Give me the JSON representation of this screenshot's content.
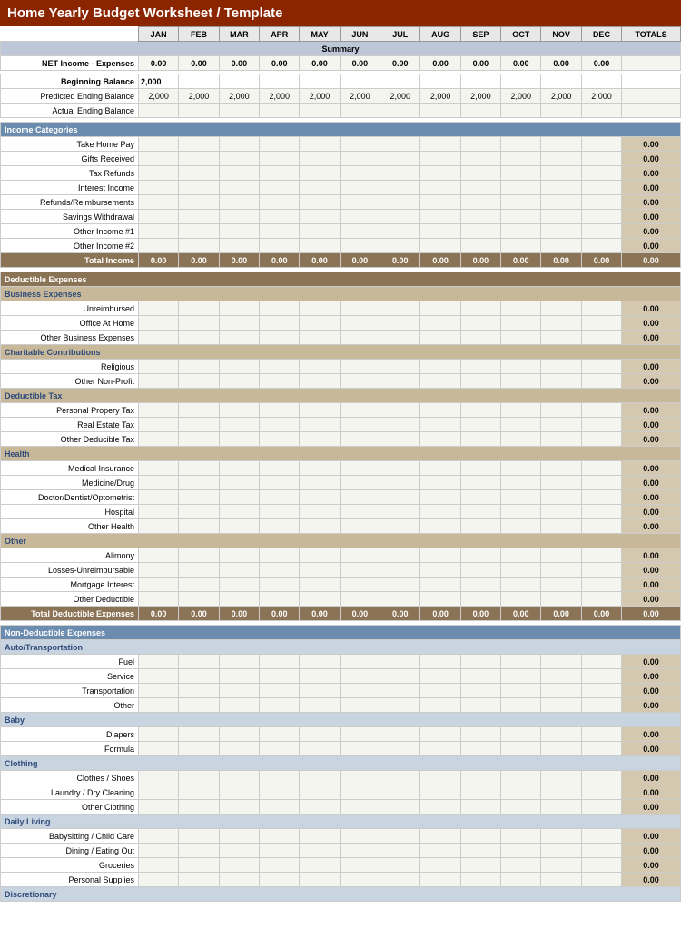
{
  "title": "Home Yearly Budget Worksheet / Template",
  "columns": [
    "",
    "JAN",
    "FEB",
    "MAR",
    "APR",
    "MAY",
    "JUN",
    "JUL",
    "AUG",
    "SEP",
    "OCT",
    "NOV",
    "DEC",
    "TOTALS"
  ],
  "summary": {
    "label": "Summary",
    "net_income_label": "NET Income - Expenses",
    "beginning_balance_label": "Beginning Balance",
    "beginning_balance_value": "2,000",
    "predicted_ending_label": "Predicted Ending Balance",
    "actual_ending_label": "Actual Ending Balance",
    "predicted_values": [
      "2,000",
      "2,000",
      "2,000",
      "2,000",
      "2,000",
      "2,000",
      "2,000",
      "2,000",
      "2,000",
      "2,000",
      "2,000",
      "2,000"
    ],
    "zero_row": [
      "0.00",
      "0.00",
      "0.00",
      "0.00",
      "0.00",
      "0.00",
      "0.00",
      "0.00",
      "0.00",
      "0.00",
      "0.00",
      "0.00",
      ""
    ]
  },
  "income": {
    "section_label": "Income Categories",
    "items": [
      "Take Home Pay",
      "Gifts Received",
      "Tax Refunds",
      "Interest Income",
      "Refunds/Reimbursements",
      "Savings Withdrawal",
      "Other Income #1",
      "Other Income #2"
    ],
    "total_label": "Total Income",
    "total_values": [
      "0.00",
      "0.00",
      "0.00",
      "0.00",
      "0.00",
      "0.00",
      "0.00",
      "0.00",
      "0.00",
      "0.00",
      "0.00",
      "0.00",
      "0.00"
    ]
  },
  "deductible": {
    "section_label": "Deductible Expenses",
    "subsections": [
      {
        "name": "Business Expenses",
        "items": [
          "Unreimbursed",
          "Office At Home",
          "Other Business Expenses"
        ]
      },
      {
        "name": "Charitable Contributions",
        "items": [
          "Religious",
          "Other Non-Profit"
        ]
      },
      {
        "name": "Deductible Tax",
        "items": [
          "Personal Propery Tax",
          "Real Estate Tax",
          "Other Deducible Tax"
        ]
      },
      {
        "name": "Health",
        "items": [
          "Medical Insurance",
          "Medicine/Drug",
          "Doctor/Dentist/Optometrist",
          "Hospital",
          "Other Health"
        ]
      },
      {
        "name": "Other",
        "items": [
          "Alimony",
          "Losses-Unreimbursable",
          "Mortgage Interest",
          "Other Deductible"
        ]
      }
    ],
    "total_label": "Total Deductible Expenses",
    "total_values": [
      "0.00",
      "0.00",
      "0.00",
      "0.00",
      "0.00",
      "0.00",
      "0.00",
      "0.00",
      "0.00",
      "0.00",
      "0.00",
      "0.00",
      "0.00"
    ]
  },
  "nondeductible": {
    "section_label": "Non-Deductible Expenses",
    "subsections": [
      {
        "name": "Auto/Transportation",
        "items": [
          "Fuel",
          "Service",
          "Transportation",
          "Other"
        ]
      },
      {
        "name": "Baby",
        "items": [
          "Diapers",
          "Formula"
        ]
      },
      {
        "name": "Clothing",
        "items": [
          "Clothes / Shoes",
          "Laundry / Dry Cleaning",
          "Other Clothing"
        ]
      },
      {
        "name": "Daily Living",
        "items": [
          "Babysitting / Child Care",
          "Dining / Eating Out",
          "Groceries",
          "Personal Supplies"
        ]
      },
      {
        "name": "Discretionary",
        "items": []
      }
    ]
  }
}
